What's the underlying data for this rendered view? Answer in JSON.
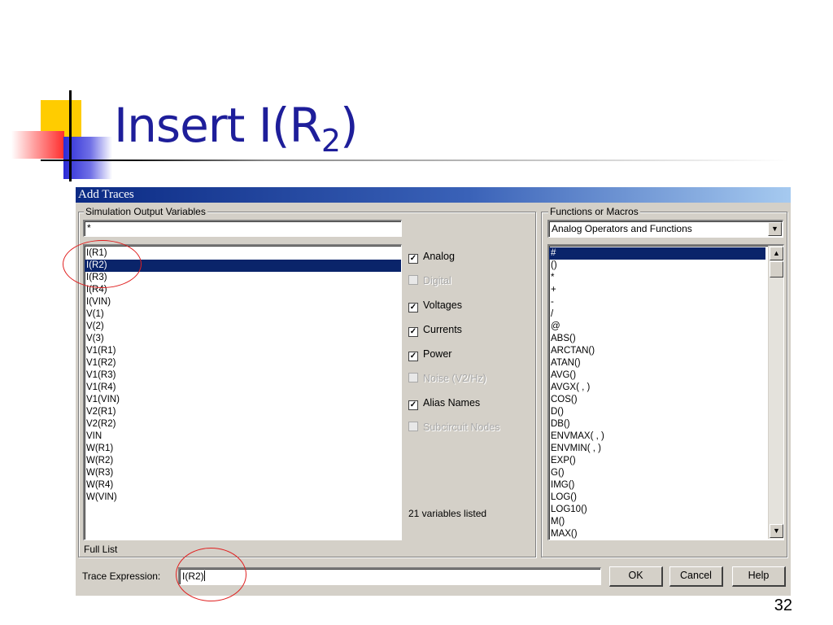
{
  "slide": {
    "title_prefix": "Insert I(R",
    "title_subscript": "2",
    "title_suffix": ")",
    "page_number": "32"
  },
  "dialog": {
    "title": "Add Traces",
    "sim_group_label": "Simulation Output Variables",
    "filter_value": "*",
    "variables": [
      "I(R1)",
      "I(R2)",
      "I(R3)",
      "I(R4)",
      "I(VIN)",
      "V(1)",
      "V(2)",
      "V(3)",
      "V1(R1)",
      "V1(R2)",
      "V1(R3)",
      "V1(R4)",
      "V1(VIN)",
      "V2(R1)",
      "V2(R2)",
      "VIN",
      "W(R1)",
      "W(R2)",
      "W(R3)",
      "W(R4)",
      "W(VIN)"
    ],
    "selected_variable": "I(R2)",
    "checkboxes": [
      {
        "label": "Analog",
        "checked": true,
        "enabled": true
      },
      {
        "label": "Digital",
        "checked": false,
        "enabled": false
      },
      {
        "label": "Voltages",
        "checked": true,
        "enabled": true
      },
      {
        "label": "Currents",
        "checked": true,
        "enabled": true
      },
      {
        "label": "Power",
        "checked": true,
        "enabled": true
      },
      {
        "label": "Noise (V2/Hz)",
        "checked": false,
        "enabled": false
      },
      {
        "label": "Alias Names",
        "checked": true,
        "enabled": true
      },
      {
        "label": "Subcircuit Nodes",
        "checked": false,
        "enabled": false
      }
    ],
    "variables_count_text": "21 variables listed",
    "full_list_label": "Full List",
    "functions_group_label": "Functions or Macros",
    "functions_dropdown_value": "Analog Operators and Functions",
    "functions": [
      "#",
      "()",
      "*",
      "+",
      "-",
      "/",
      "@",
      "ABS()",
      "ARCTAN()",
      "ATAN()",
      "AVG()",
      "AVGX( , )",
      "COS()",
      "D()",
      "DB()",
      "ENVMAX( , )",
      "ENVMIN( , )",
      "EXP()",
      "G()",
      "IMG()",
      "LOG()",
      "LOG10()",
      "M()",
      "MAX()"
    ],
    "selected_function": "#",
    "trace_expression_label": "Trace Expression:",
    "trace_expression_value": "I(R2)",
    "ok_label": "OK",
    "cancel_label": "Cancel",
    "help_label": "Help"
  },
  "colors": {
    "title_blue": "#1e1e9a",
    "selection": "#0a246a",
    "annotation_red": "#e02020"
  }
}
